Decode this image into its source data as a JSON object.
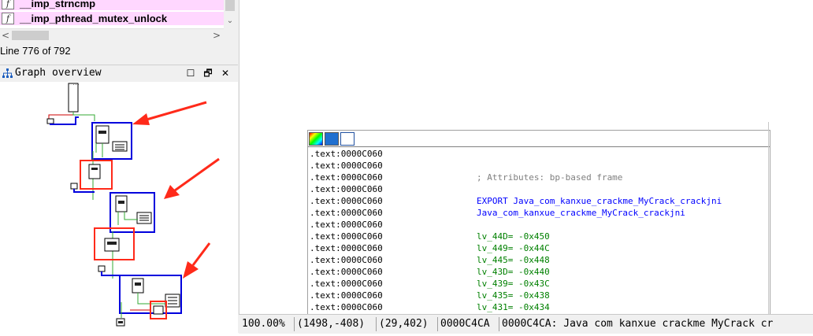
{
  "functions": {
    "items": [
      {
        "icon": "f",
        "name": "__imp_strncmp"
      },
      {
        "icon": "f",
        "name": "__imp_pthread_mutex_unlock"
      }
    ]
  },
  "scroll": {
    "down_arrow": "⌄",
    "left_arrow": "<",
    "right_arrow": ">"
  },
  "line_status": "Line 776 of 792",
  "graph_overview": {
    "title": "Graph overview",
    "buttons": {
      "maximize": "☐",
      "restore": "🗗",
      "close": "✕"
    },
    "node_label": "..."
  },
  "disasm": {
    "lines": [
      {
        "addr": ".text:0000C060",
        "code": "",
        "style": ""
      },
      {
        "addr": ".text:0000C060",
        "code": "",
        "style": ""
      },
      {
        "addr": ".text:0000C060",
        "code": "; Attributes: bp-based frame",
        "style": "comment"
      },
      {
        "addr": ".text:0000C060",
        "code": "",
        "style": ""
      },
      {
        "addr": ".text:0000C060",
        "code": "EXPORT Java_com_kanxue_crackme_MyCrack_crackjni",
        "style": "blue"
      },
      {
        "addr": ".text:0000C060",
        "code": "Java_com_kanxue_crackme_MyCrack_crackjni",
        "style": "blue"
      },
      {
        "addr": ".text:0000C060",
        "code": "",
        "style": ""
      },
      {
        "addr": ".text:0000C060",
        "code": "lv_44D= -0x450",
        "style": "green"
      },
      {
        "addr": ".text:0000C060",
        "code": "lv_449= -0x44C",
        "style": "green"
      },
      {
        "addr": ".text:0000C060",
        "code": "lv_445= -0x448",
        "style": "green"
      },
      {
        "addr": ".text:0000C060",
        "code": "lv_43D= -0x440",
        "style": "green"
      },
      {
        "addr": ".text:0000C060",
        "code": "lv_439= -0x43C",
        "style": "green"
      },
      {
        "addr": ".text:0000C060",
        "code": "lv_435= -0x438",
        "style": "green"
      },
      {
        "addr": ".text:0000C060",
        "code": "lv_431= -0x434",
        "style": "green"
      }
    ]
  },
  "status_bar": {
    "zoom": "100.00%",
    "graph_coords": "(1498,-408)",
    "view_coords": "(29,402)",
    "offset": "0000C4CA",
    "location": "0000C4CA: Java com kanxue crackme MyCrack cr"
  },
  "colors": {
    "func_bg": "#ffd7ff",
    "annotation_red": "#ff2a1a",
    "highlight_blue": "#0000dd",
    "edge_green": "#33aa33"
  }
}
